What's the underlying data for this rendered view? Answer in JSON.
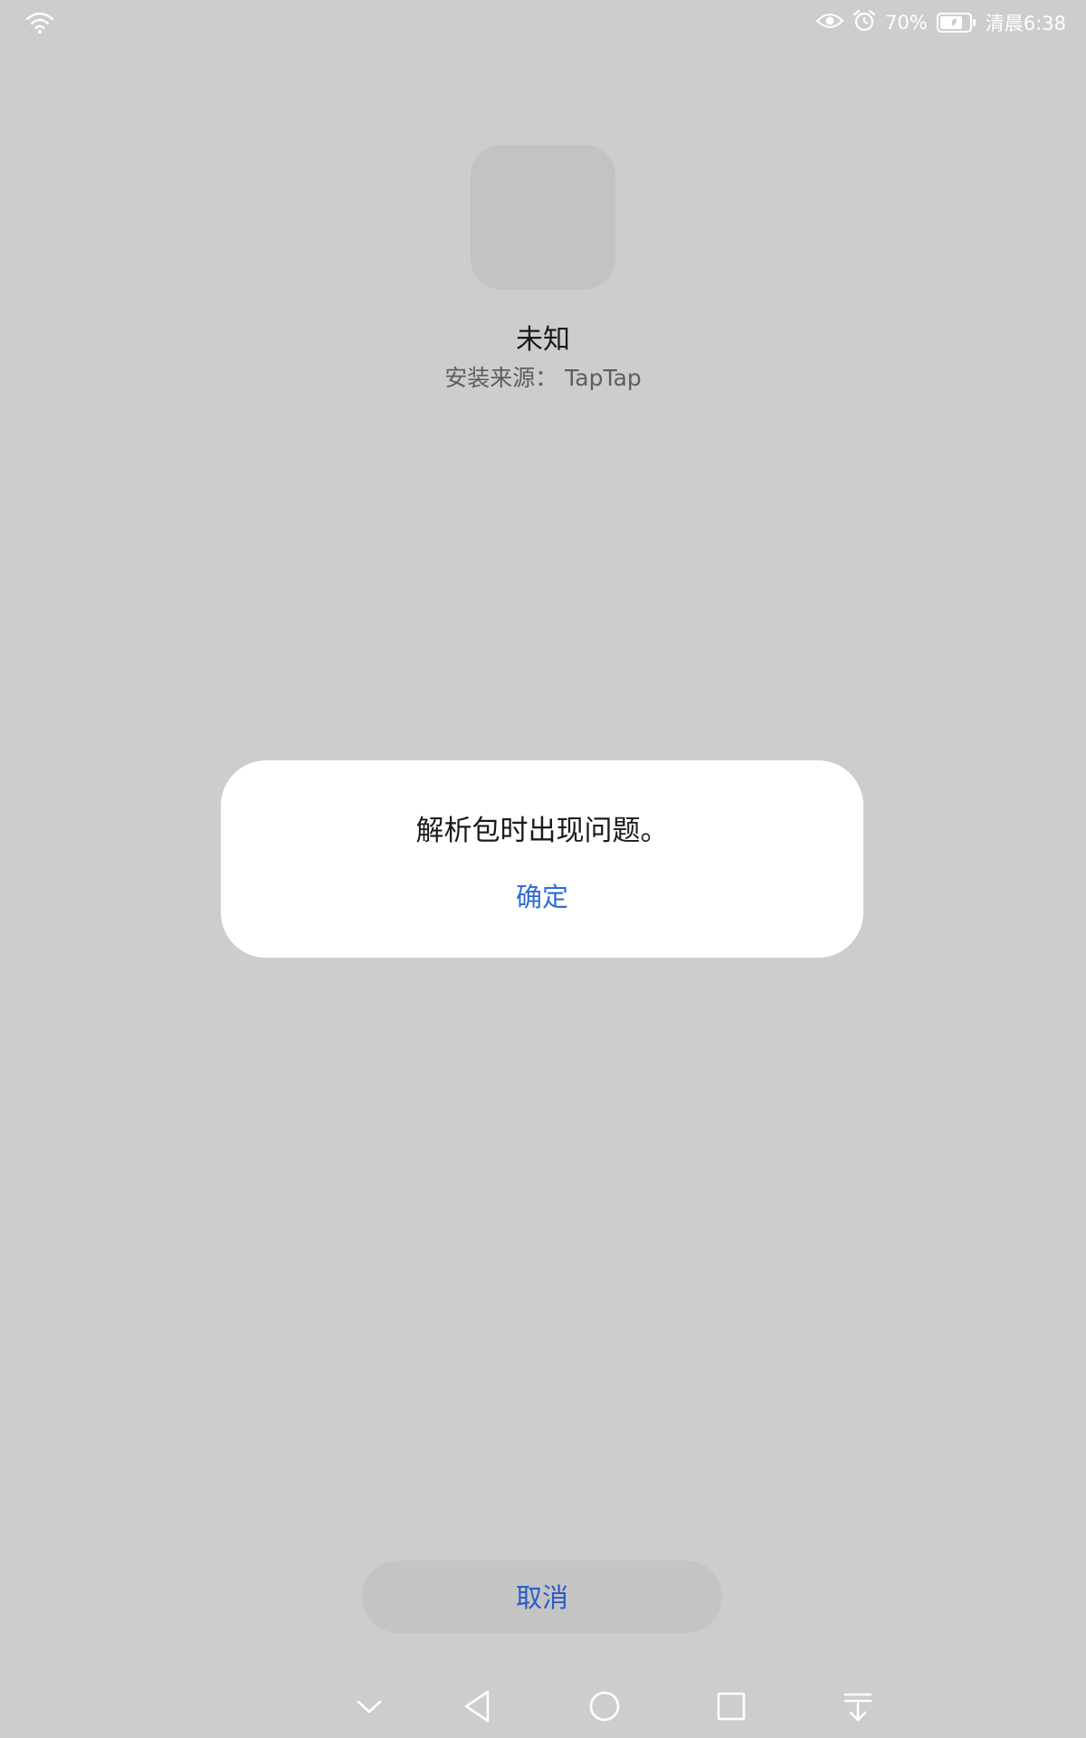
{
  "status_bar": {
    "battery_percent": "70%",
    "time": "清晨6:38",
    "icons": [
      "wifi-icon",
      "eye-icon",
      "alarm-icon",
      "battery-icon"
    ]
  },
  "app": {
    "name": "未知",
    "install_source": "安装来源： TapTap"
  },
  "dialog": {
    "message": "解析包时出现问题。",
    "confirm_label": "确定"
  },
  "cancel_label": "取消",
  "nav_bar": {
    "icons": [
      "chevron-down-icon",
      "back-icon",
      "home-icon",
      "recents-icon",
      "notification-pull-icon"
    ]
  },
  "colors": {
    "background": "#cdcdcd",
    "accent": "#2f6bd6",
    "dialog": "#ffffff"
  }
}
